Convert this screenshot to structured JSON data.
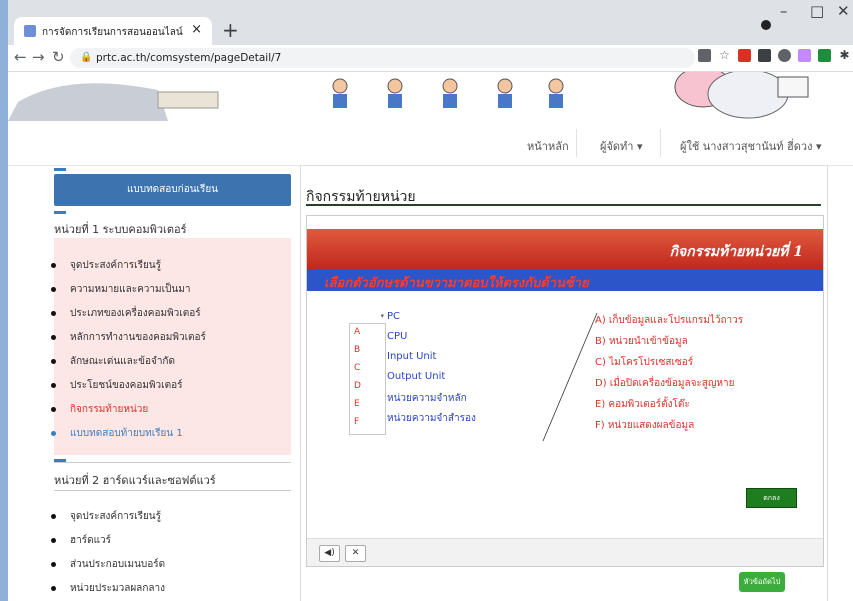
{
  "browser": {
    "tab_title": "การจัดการเรียนการสอนออนไลน์",
    "url": "prtc.ac.th/comsystem/pageDetail/7"
  },
  "nav": {
    "home": "หน้าหลัก",
    "author": "ผู้จัดทำ",
    "user": "ผู้ใช้ นางสาวสุชานันท์ ฮี่ดวง"
  },
  "sidebar": {
    "pretest": "แบบทดสอบก่อนเรียน",
    "unit1": {
      "title": "หน่วยที่ 1 ระบบคอมพิวเตอร์",
      "items": [
        "จุดประสงค์การเรียนรู้",
        "ความหมายและความเป็นมา",
        "ประเภทของเครื่องคอมพิวเตอร์",
        "หลักการทำงานของคอมพิวเตอร์",
        "ลักษณะเด่นและข้อจำกัด",
        "ประโยชน์ของคอมพิวเตอร์",
        "กิจกรรมท้ายหน่วย",
        "แบบทดสอบท้ายบทเรียน 1"
      ]
    },
    "unit2": {
      "title": "หน่วยที่ 2 ฮาร์ดแวร์และซอฟต์แวร์",
      "items": [
        "จุดประสงค์การเรียนรู้",
        "ฮาร์ดแวร์",
        "ส่วนประกอบเมนบอร์ด",
        "หน่วยประมวลผลกลาง"
      ]
    }
  },
  "main": {
    "title": "กิจกรรมท้ายหน่วย",
    "activity_header": "กิจกรรมท้ายหน่วยที่ 1",
    "instruction": "เลือกตัวอักษรด้านขวามาตอบให้ตรงกับด้านซ้าย",
    "left_items": [
      "PC",
      "CPU",
      "Input Unit",
      "Output Unit",
      "หน่วยความจำหลัก",
      "หน่วยความจำสำรอง"
    ],
    "letters": [
      "A",
      "B",
      "C",
      "D",
      "E",
      "F"
    ],
    "right_items": [
      "A) เก็บข้อมูลและโปรแกรมไว้ถาวร",
      "B) หน่วยนำเข้าข้อมูล",
      "C) ไมโครโปรเซสเซอร์",
      "D) เมื่อปิดเครื่องข้อมูลจะสูญหาย",
      "E) คอมพิวเตอร์ตั้งโต๊ะ",
      "F) หน่วยแสดงผลข้อมูล"
    ],
    "ok_label": "ตกลง",
    "ctrl_sound": "◀)",
    "ctrl_close": "✕",
    "next_label": "หัวข้อถัดไป"
  },
  "colors": {
    "pretest_bg": "#3d74b0",
    "active_item": "#d9342b",
    "link_item": "#3a7ec2",
    "ok_bg": "#1e7d1e",
    "next_bg": "#3cad3c"
  }
}
